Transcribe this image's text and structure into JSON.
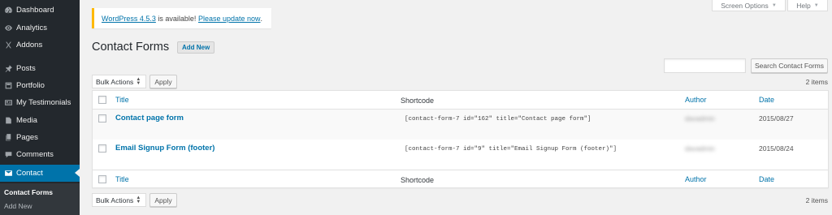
{
  "sidebar": {
    "items": [
      {
        "label": "Dashboard",
        "icon": "dashboard-icon"
      },
      {
        "label": "Analytics",
        "icon": "analytics-icon"
      },
      {
        "label": "Addons",
        "icon": "addons-icon"
      },
      {
        "label": "Posts",
        "icon": "pin-icon"
      },
      {
        "label": "Portfolio",
        "icon": "portfolio-icon"
      },
      {
        "label": "My Testimonials",
        "icon": "testimonials-icon"
      },
      {
        "label": "Media",
        "icon": "media-icon"
      },
      {
        "label": "Pages",
        "icon": "pages-icon"
      },
      {
        "label": "Comments",
        "icon": "comments-icon"
      },
      {
        "label": "Contact",
        "icon": "mail-icon"
      }
    ],
    "submenu": [
      {
        "label": "Contact Forms"
      },
      {
        "label": "Add New"
      }
    ]
  },
  "top_tabs": {
    "screen_options": "Screen Options",
    "help": "Help"
  },
  "notice": {
    "version_link": "WordPress 4.5.3",
    "text": "is available!",
    "update_link": "Please update now",
    "suffix": "."
  },
  "header": {
    "title": "Contact Forms",
    "add_new": "Add New"
  },
  "search": {
    "value": "",
    "button": "Search Contact Forms"
  },
  "bulk": {
    "select_value": "Bulk Actions",
    "apply": "Apply",
    "count": "2 items"
  },
  "table": {
    "columns": [
      "Title",
      "Shortcode",
      "Author",
      "Date"
    ],
    "rows": [
      {
        "title": "Contact page form",
        "shortcode": "[contact-form-7 id=\"162\" title=\"Contact page form\"]",
        "author": "davadmin",
        "date": "2015/08/27"
      },
      {
        "title": "Email Signup Form (footer)",
        "shortcode": "[contact-form-7 id=\"9\" title=\"Email Signup Form (footer)\"]",
        "author": "davadmin",
        "date": "2015/08/24"
      }
    ]
  },
  "colors": {
    "sidebar_bg": "#23282d",
    "active": "#0073aa",
    "link": "#0073aa",
    "notice_border": "#ffb900"
  }
}
